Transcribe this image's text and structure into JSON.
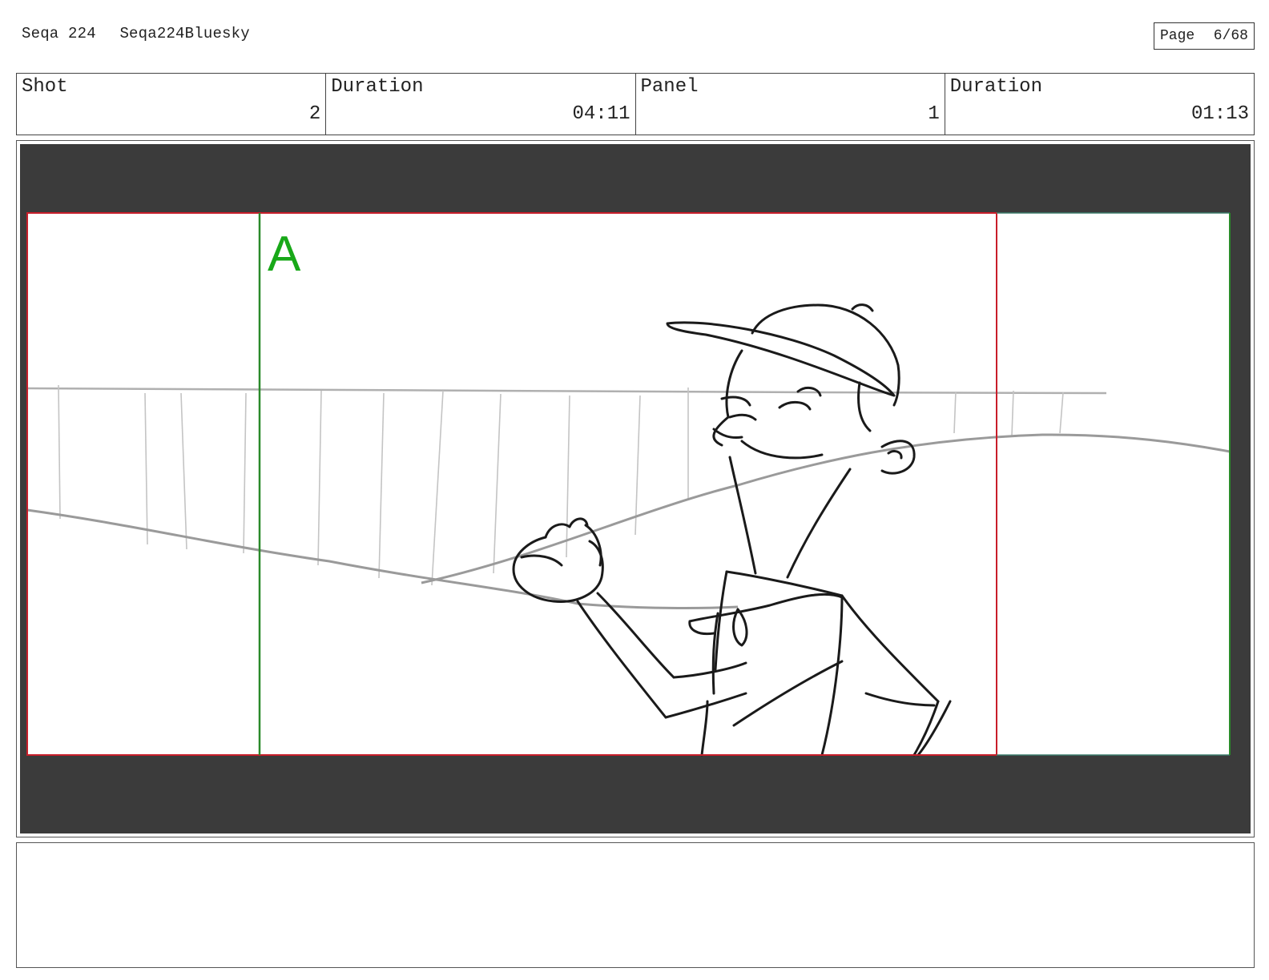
{
  "header": {
    "sequence": "Seqa 224",
    "sequence_name": "Seqa224Bluesky",
    "page_label": "Page",
    "page_number": "6/68"
  },
  "info": {
    "shot_label": "Shot",
    "shot_value": "2",
    "shot_duration_label": "Duration",
    "shot_duration_value": "04:11",
    "panel_label": "Panel",
    "panel_value": "1",
    "panel_duration_label": "Duration",
    "panel_duration_value": "01:13"
  },
  "frame": {
    "camera_marker": "A",
    "marker_color": "#18a818",
    "safe_frame_color": "#c81e2a",
    "camera_line_color": "#2a8a2a"
  },
  "notes": {
    "text": ""
  }
}
